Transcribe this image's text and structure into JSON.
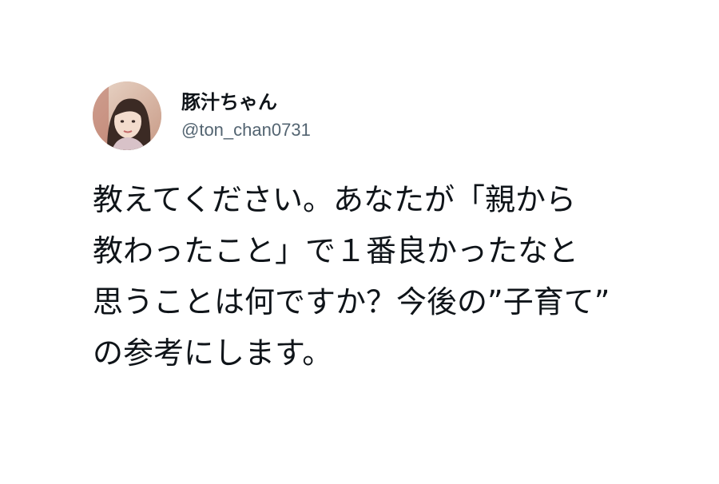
{
  "tweet": {
    "author": {
      "display_name": "豚汁ちゃん",
      "handle": "@ton_chan0731",
      "avatar_icon": "profile-photo"
    },
    "text_lines": [
      "教えてください。あなたが「親から",
      "教わったこと」で１番良かったなと",
      "思うことは何ですか？今後の”子育て”",
      "の参考にします。"
    ]
  },
  "colors": {
    "text": "#0f1419",
    "handle": "#536471",
    "background": "#ffffff"
  }
}
